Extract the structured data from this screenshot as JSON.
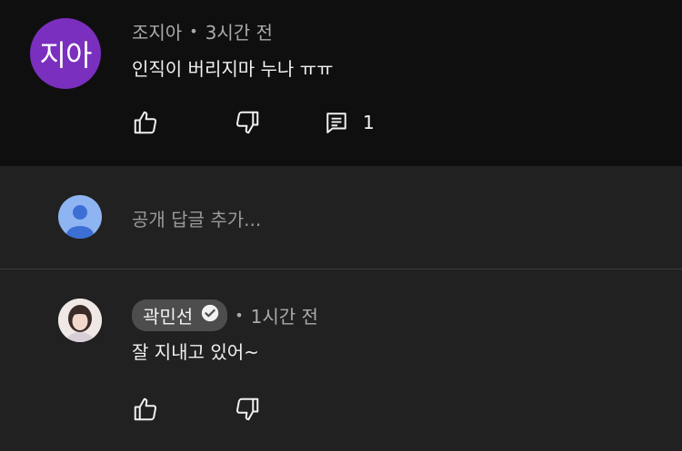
{
  "top_comment": {
    "avatar_text": "지아",
    "author": "조지아",
    "separator": "•",
    "time": "3시간 전",
    "text": "인직이 버리지마 누나 ㅠㅠ",
    "reply_count": "1",
    "icons": {
      "like": "thumbs-up-icon",
      "dislike": "thumbs-down-icon",
      "reply": "comment-icon"
    }
  },
  "reply_box": {
    "placeholder": "공개 답글 추가..."
  },
  "reply": {
    "author": "곽민선",
    "separator": "•",
    "time": "1시간 전",
    "text": "잘 지내고 있어~",
    "verified_icon": "check-circle-icon"
  },
  "colors": {
    "background": "#0f0f0f",
    "reply_panel": "#212121",
    "avatar_purple": "#7b2fbf",
    "owner_chip": "#4d4d4d"
  }
}
